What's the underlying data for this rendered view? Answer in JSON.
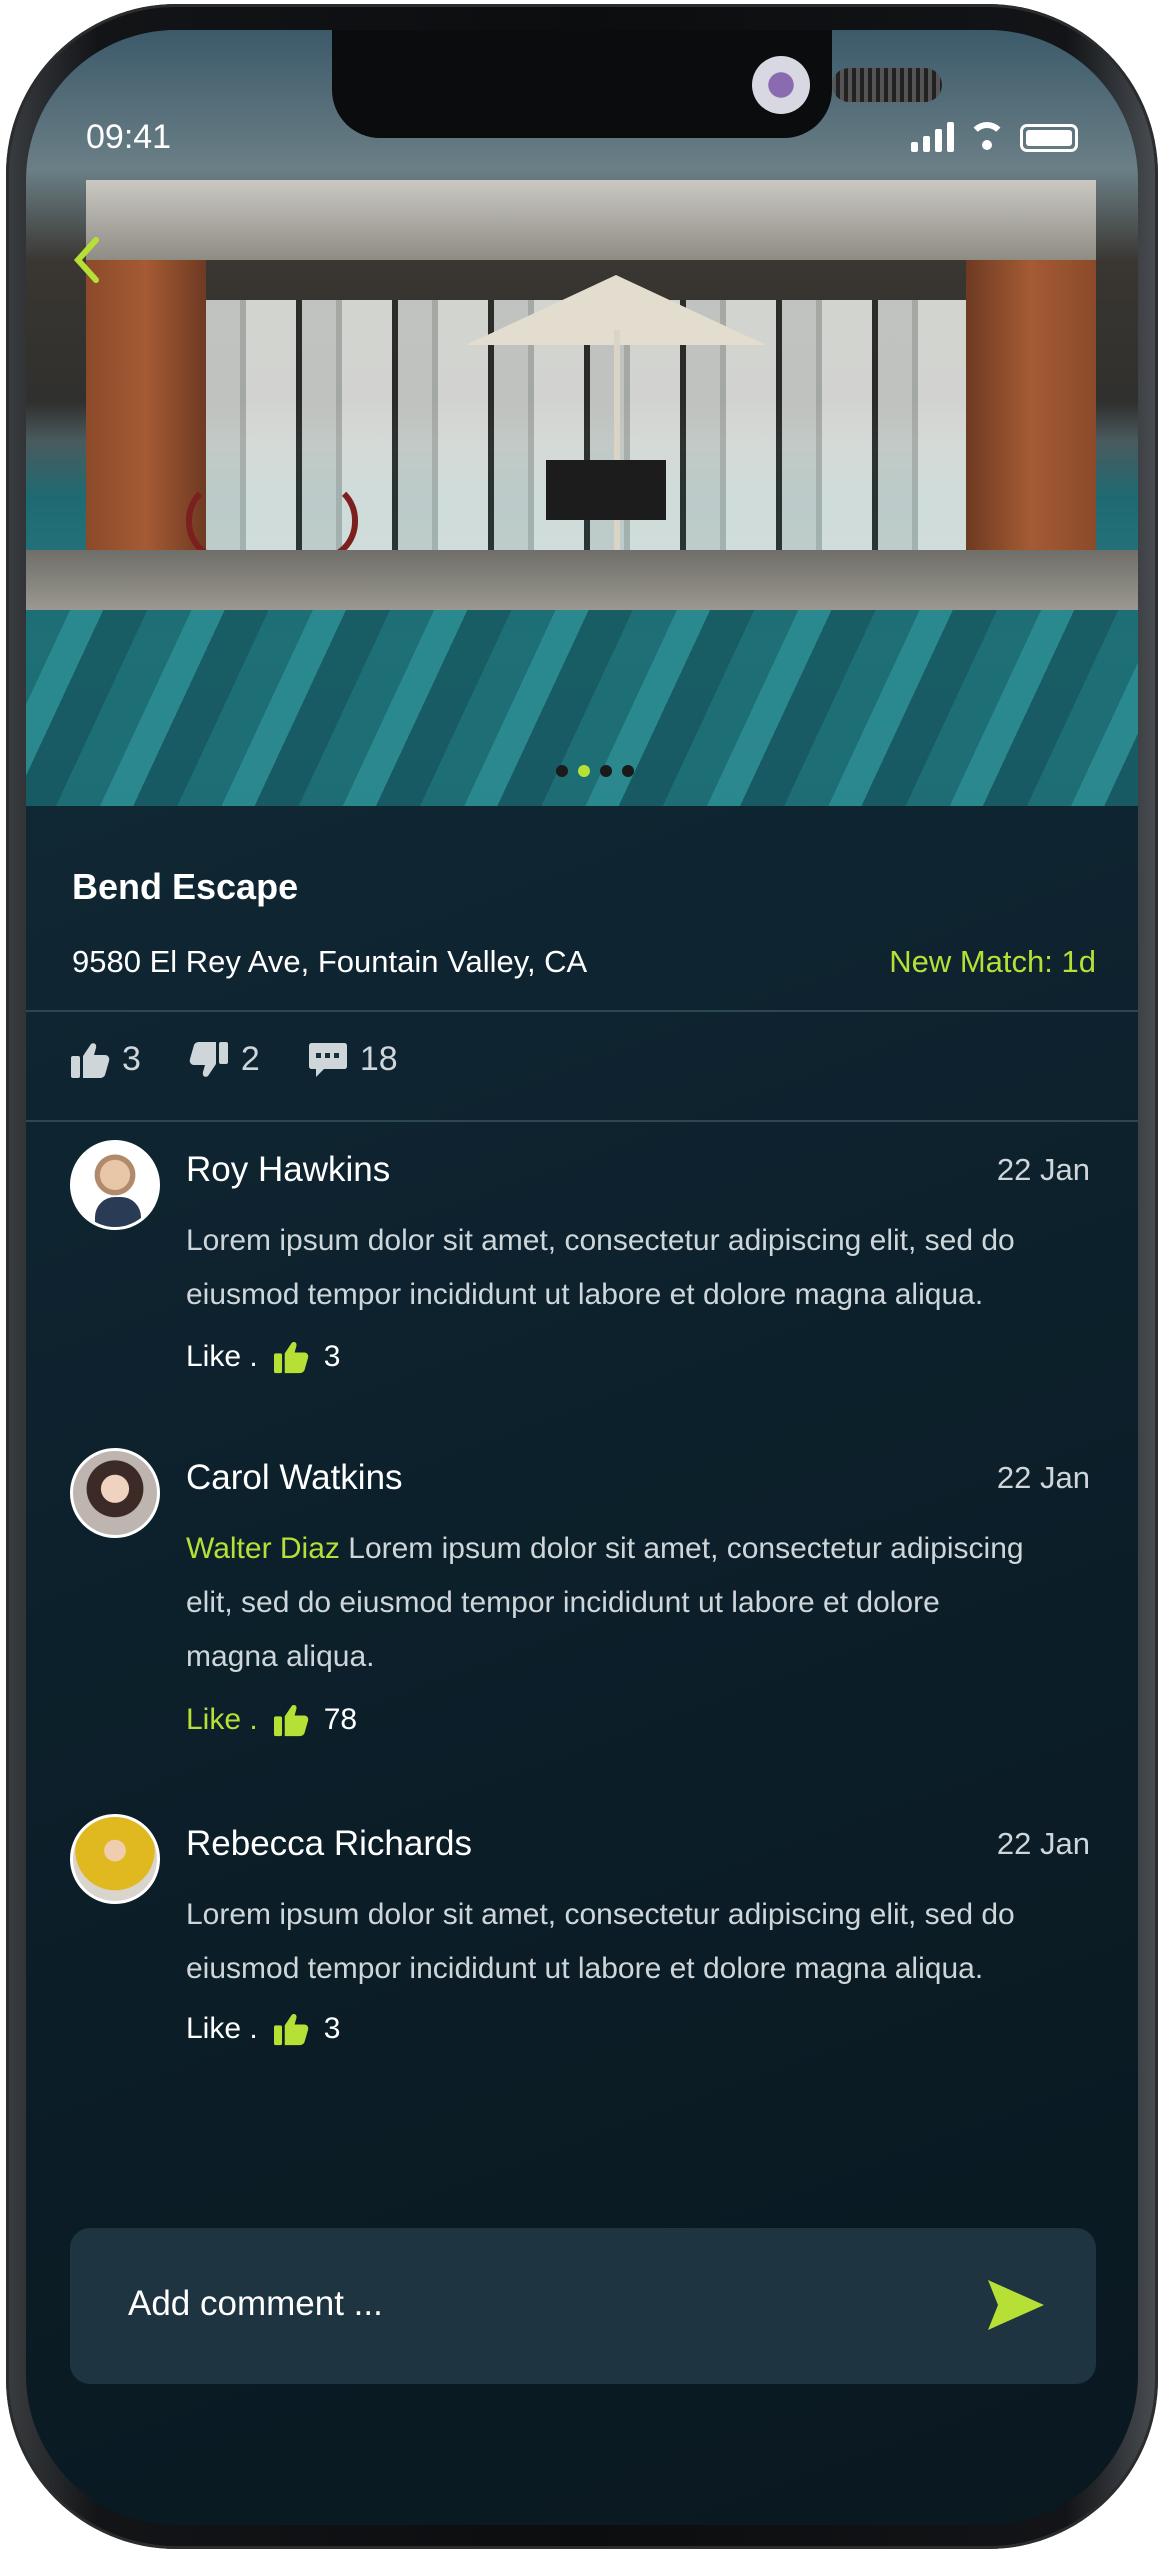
{
  "status_bar": {
    "time": "09:41"
  },
  "listing": {
    "title": "Bend Escape",
    "address": "9580 El Rey Ave, Fountain Valley, CA",
    "match": "New Match: 1d",
    "likes": "3",
    "dislikes": "2",
    "comments": "18"
  },
  "gallery": {
    "page_count": 4,
    "active_page": 2
  },
  "comments": [
    {
      "name": "Roy Hawkins",
      "date": "22 Jan",
      "mention": "",
      "text_line1": "Lorem ipsum dolor sit amet, consectetur adipiscing elit, sed do",
      "text_line2": "eiusmod tempor incididunt ut labore et dolore magna aliqua.",
      "text_line3": "",
      "like_label": "Like .",
      "like_count": "3"
    },
    {
      "name": "Carol Watkins",
      "date": "22 Jan",
      "mention": "Walter Diaz",
      "text_line1": "Lorem ipsum dolor sit amet, consectetur adipiscing",
      "text_line2": "elit, sed do eiusmod tempor incididunt ut labore et dolore",
      "text_line3": "magna aliqua.",
      "like_label": "Like .",
      "like_count": "78"
    },
    {
      "name": "Rebecca Richards",
      "date": "22 Jan",
      "mention": "",
      "text_line1": "Lorem ipsum dolor sit amet, consectetur adipiscing elit, sed do",
      "text_line2": "eiusmod tempor incididunt ut labore et dolore magna aliqua.",
      "text_line3": "",
      "like_label": "Like .",
      "like_count": "3"
    }
  ],
  "composer": {
    "placeholder": "Add comment ..."
  },
  "colors": {
    "accent": "#b6e036",
    "background": "#0e2430",
    "input_bg": "#1e3440"
  },
  "icons": {
    "back": "chevron-left-icon",
    "like": "thumbs-up-icon",
    "dislike": "thumbs-down-icon",
    "comment": "comment-icon",
    "send": "send-icon"
  }
}
